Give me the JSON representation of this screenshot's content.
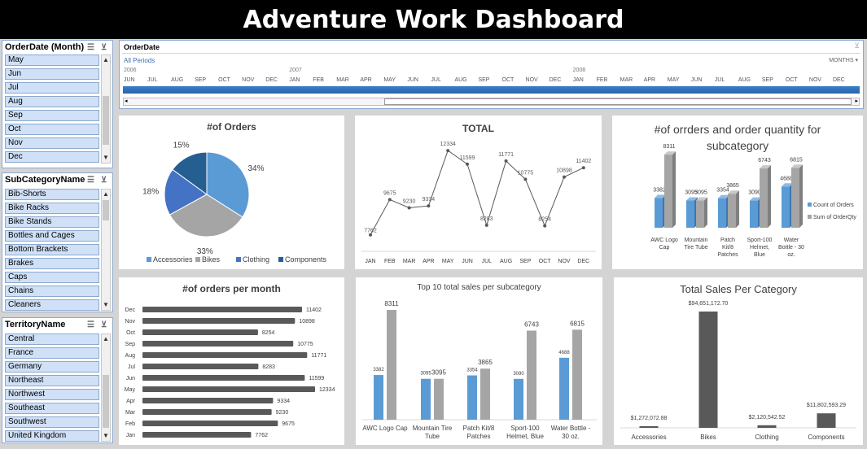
{
  "title": "Adventure Work Dashboard",
  "slicers": {
    "month": {
      "title": "OrderDate (Month)",
      "items": [
        "May",
        "Jun",
        "Jul",
        "Aug",
        "Sep",
        "Oct",
        "Nov",
        "Dec"
      ]
    },
    "subcategory": {
      "title": "SubCategoryName",
      "items": [
        "Bib-Shorts",
        "Bike Racks",
        "Bike Stands",
        "Bottles and Cages",
        "Bottom Brackets",
        "Brakes",
        "Caps",
        "Chains",
        "Cleaners"
      ]
    },
    "territory": {
      "title": "TerritoryName",
      "items": [
        "Central",
        "France",
        "Germany",
        "Northeast",
        "Northwest",
        "Southeast",
        "Southwest",
        "United Kingdom"
      ]
    }
  },
  "timeline": {
    "title": "OrderDate",
    "period_label": "All Periods",
    "level": "MONTHS",
    "years": [
      "2006",
      "2007",
      "2008"
    ],
    "months": [
      "JUN",
      "JUL",
      "AUG",
      "SEP",
      "OCT",
      "NOV",
      "DEC",
      "JAN",
      "FEB",
      "MAR",
      "APR",
      "MAY",
      "JUN",
      "JUL",
      "AUG",
      "SEP",
      "OCT",
      "NOV",
      "DEC",
      "JAN",
      "FEB",
      "MAR",
      "APR",
      "MAY",
      "JUN",
      "JUL",
      "AUG",
      "SEP",
      "OCT",
      "NOV",
      "DEC"
    ]
  },
  "charts": {
    "orders_pie": {
      "title": "#of Orders"
    },
    "total_line": {
      "title": "TOTAL"
    },
    "subcat_orders": {
      "title_line1": "#of orrders and order quantity for",
      "title_line2": "subcategory"
    },
    "orders_month": {
      "title": "#of orders per month"
    },
    "top10_sales": {
      "title": "Top 10 total sales per subcategory"
    },
    "sales_category": {
      "title": "Total Sales Per Category"
    }
  },
  "chart_data": [
    {
      "type": "pie",
      "title": "#of Orders",
      "categories": [
        "Accessories",
        "Bikes",
        "Clothing",
        "Components"
      ],
      "values": [
        34,
        33,
        18,
        15
      ],
      "labels": [
        "34%",
        "33%",
        "18%",
        "15%"
      ],
      "colors": [
        "#5b9bd5",
        "#a5a5a5",
        "#4472c4",
        "#255e91"
      ],
      "legend": "bottom"
    },
    {
      "type": "line",
      "title": "TOTAL",
      "categories": [
        "JAN",
        "FEB",
        "MAR",
        "APR",
        "MAY",
        "JUN",
        "JUL",
        "AUG",
        "SEP",
        "OCT",
        "NOV",
        "DEC"
      ],
      "values": [
        7762,
        9675,
        9230,
        9334,
        12334,
        11599,
        8283,
        11771,
        10775,
        8254,
        10898,
        11402
      ],
      "color": "#595959"
    },
    {
      "type": "bar",
      "title": "#of orrders and order quantity for subcategory",
      "categories": [
        "AWC Logo Cap",
        "Mountain Tire Tube",
        "Patch Kit/8 Patches",
        "Sport-100 Helmet, Blue",
        "Water Bottle - 30 oz."
      ],
      "category_lines": [
        [
          "AWC Logo",
          "Cap"
        ],
        [
          "Mountain",
          "Tire Tube"
        ],
        [
          "Patch",
          "Kit/8",
          "Patches"
        ],
        [
          "Sport-100",
          "Helmet,",
          "Blue"
        ],
        [
          "Water",
          "Bottle - 30",
          "oz."
        ]
      ],
      "series": [
        {
          "name": "Count of Orders",
          "values": [
            3382,
            3095,
            3354,
            3090,
            4688
          ],
          "color": "#5b9bd5"
        },
        {
          "name": "Sum of OrderQty",
          "values": [
            8311,
            3095,
            3865,
            6743,
            6815
          ],
          "color": "#a5a5a5"
        }
      ],
      "legend": "right"
    },
    {
      "type": "bar",
      "orientation": "horizontal",
      "title": "#of orders per month",
      "categories": [
        "Dec",
        "Nov",
        "Oct",
        "Sep",
        "Aug",
        "Jul",
        "Jun",
        "May",
        "Apr",
        "Mar",
        "Feb",
        "Jan"
      ],
      "values": [
        11402,
        10898,
        8254,
        10775,
        11771,
        8283,
        11599,
        12334,
        9334,
        9230,
        9675,
        7762
      ],
      "color": "#595959"
    },
    {
      "type": "bar",
      "title": "Top 10 total sales per subcategory",
      "categories": [
        "AWC Logo Cap",
        "Mountain Tire Tube",
        "Patch Kit/8 Patches",
        "Sport-100 Helmet, Blue",
        "Water Bottle - 30 oz."
      ],
      "category_lines": [
        [
          "AWC Logo Cap"
        ],
        [
          "Mountain Tire",
          "Tube"
        ],
        [
          "Patch Kit/8",
          "Patches"
        ],
        [
          "Sport-100",
          "Helmet, Blue"
        ],
        [
          "Water Bottle -",
          "30 oz."
        ]
      ],
      "series": [
        {
          "values": [
            3382,
            3095,
            3354,
            3090,
            4688
          ],
          "color": "#5b9bd5"
        },
        {
          "values": [
            8311,
            3095,
            3865,
            6743,
            6815
          ],
          "color": "#a5a5a5"
        }
      ]
    },
    {
      "type": "bar",
      "title": "Total Sales Per Category",
      "categories": [
        "Accessories",
        "Bikes",
        "Clothing",
        "Components"
      ],
      "values": [
        1272072.88,
        94651172.7,
        2120542.52,
        11802593.29
      ],
      "labels": [
        "$1,272,072.88",
        "$94,651,172.70",
        "$2,120,542.52",
        "$11,802,593.29"
      ],
      "color": "#595959"
    }
  ]
}
